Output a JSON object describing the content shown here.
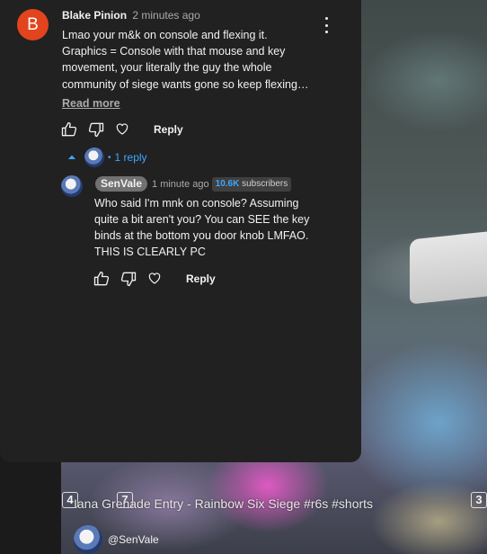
{
  "comment": {
    "avatar_letter": "B",
    "author": "Blake Pinion",
    "time": "2 minutes ago",
    "lines": [
      "Lmao your m&k on console and flexing it.",
      "Graphics = Console with that mouse and key",
      "movement, your literally the guy the whole",
      "community of siege wants gone so keep flexing…"
    ],
    "read_more": "Read more",
    "reply_label": "Reply",
    "reply_count": "1 reply"
  },
  "reply": {
    "author": "SenVale",
    "time": "1 minute ago",
    "subs_count": "10.6K",
    "subs_label": "subscribers",
    "lines": [
      "Who said I'm mnk on console? Assuming",
      "quite a bit aren't you? You can SEE the key",
      "binds at the bottom you door knob LMFAO.",
      "THIS IS CLEARLY PC"
    ],
    "reply_label": "Reply"
  },
  "video": {
    "title": "Iana Grenade Entry - Rainbow Six Siege #r6s #shorts",
    "channel": "@SenVale",
    "hud_keys": [
      "4",
      "7",
      "3"
    ]
  },
  "icons": {
    "kebab": "more-vert-icon",
    "like": "thumb-up-icon",
    "dislike": "thumb-down-icon",
    "heart": "heart-icon",
    "caret": "caret-up-icon"
  },
  "colors": {
    "panel_bg": "#212121",
    "avatar_b": "#e2441d",
    "link_blue": "#3ea6ff",
    "chip_bg": "#717171"
  }
}
